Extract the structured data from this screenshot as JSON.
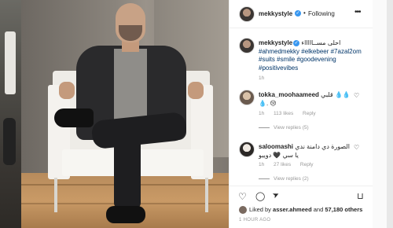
{
  "post": {
    "username": "mekkystyle",
    "verified_mark": "✓",
    "dot": "•",
    "follow_status": "Following",
    "more_icon": "•••"
  },
  "caption": {
    "username": "mekkystyle",
    "verified_mark": "✓",
    "text": "احلى مســاااااء",
    "hashtags": "#ahmedmekky #elkebeer #7azal2om #suits #smile #goodevening #positivevibes",
    "time": "1h"
  },
  "comments": [
    {
      "username": "tokka_moohaameed",
      "text": "قلبي 💧💧💧.",
      "extra": "😢",
      "time": "1h",
      "likes": "113 likes",
      "reply": "Reply",
      "view_replies": "View replies (5)"
    },
    {
      "username": "saloomashi",
      "text": "الصورة دي دامنة ندي يا سي 🖤 دويبو",
      "time": "1h",
      "likes": "27 likes",
      "reply": "Reply",
      "view_replies": "View replies (2)"
    }
  ],
  "actions": {
    "like_icon": "♡",
    "comment_icon": "◯",
    "share_icon": "➤",
    "save_icon": "⊓"
  },
  "likes_summary": {
    "prefix": "Liked by",
    "user": "asser.ahmeed",
    "and": "and",
    "others": "57,180 others"
  },
  "post_time": "1 HOUR AGO",
  "colors": {
    "link": "#003569",
    "verified": "#3897f0",
    "muted": "#999999"
  }
}
